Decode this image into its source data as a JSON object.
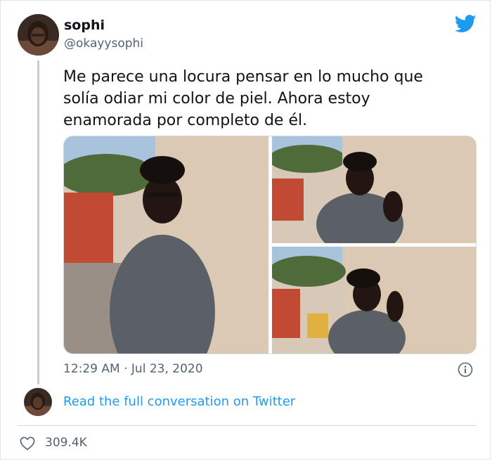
{
  "author": {
    "name": "sophi",
    "handle": "@okayysophi"
  },
  "tweet": {
    "text_line1": "Me parece una locura pensar en lo mucho que",
    "text_line2": "solía odiar mi color de piel. Ahora estoy",
    "text_line3": "enamorada por completo de él.",
    "timestamp": "12:29 AM · Jul 23, 2020"
  },
  "footer": {
    "read_link": "Read the full conversation on Twitter",
    "likes": "309.4K"
  },
  "colors": {
    "link": "#1d9bf0",
    "twitter_blue": "#1d9bf0",
    "secondary_text": "#536471"
  },
  "icons": [
    "twitter-bird-icon",
    "info-icon",
    "heart-icon"
  ]
}
